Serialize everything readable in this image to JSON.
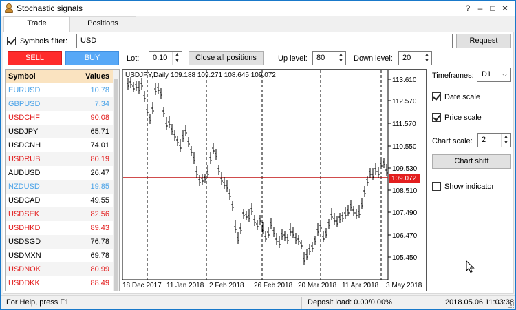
{
  "window": {
    "title": "Stochastic signals",
    "buttons": [
      "?",
      "–",
      "□",
      "✕"
    ]
  },
  "tabs": [
    {
      "label": "Trade",
      "active": true
    },
    {
      "label": "Positions",
      "active": false
    }
  ],
  "filter": {
    "label": "Symbols filter:",
    "checked": true,
    "value": "USD",
    "request_label": "Request"
  },
  "trade": {
    "sell_label": "SELL",
    "buy_label": "BUY",
    "lot_label": "Lot:",
    "lot_value": "0.10",
    "close_all_label": "Close all positions",
    "up_level_label": "Up level:",
    "up_level_value": "80",
    "down_level_label": "Down level:",
    "down_level_value": "20"
  },
  "colors": {
    "sell": "#ff2b2b",
    "buy": "#57a8f7",
    "red_text": "#e31e1e",
    "blue_text": "#4ba3e8",
    "price_line": "#c01010"
  },
  "symbols": {
    "header_symbol": "Symbol",
    "header_values": "Values",
    "rows": [
      {
        "symbol": "EURUSD",
        "value": "10.78",
        "color": "blue"
      },
      {
        "symbol": "GBPUSD",
        "value": "7.34",
        "color": "blue"
      },
      {
        "symbol": "USDCHF",
        "value": "90.08",
        "color": "red"
      },
      {
        "symbol": "USDJPY",
        "value": "65.71",
        "color": "black"
      },
      {
        "symbol": "USDCNH",
        "value": "74.01",
        "color": "black"
      },
      {
        "symbol": "USDRUB",
        "value": "80.19",
        "color": "red"
      },
      {
        "symbol": "AUDUSD",
        "value": "26.47",
        "color": "black"
      },
      {
        "symbol": "NZDUSD",
        "value": "19.85",
        "color": "blue"
      },
      {
        "symbol": "USDCAD",
        "value": "49.55",
        "color": "black"
      },
      {
        "symbol": "USDSEK",
        "value": "82.56",
        "color": "red"
      },
      {
        "symbol": "USDHKD",
        "value": "89.43",
        "color": "red"
      },
      {
        "symbol": "USDSGD",
        "value": "76.78",
        "color": "black"
      },
      {
        "symbol": "USDMXN",
        "value": "69.78",
        "color": "black"
      },
      {
        "symbol": "USDNOK",
        "value": "80.99",
        "color": "red"
      },
      {
        "symbol": "USDDKK",
        "value": "88.49",
        "color": "red"
      }
    ]
  },
  "chart": {
    "header": "USDJPY,Daily  109.188 109.271 108.645 109.072",
    "price_axis": [
      "113.610",
      "112.570",
      "111.570",
      "110.550",
      "109.530",
      "108.510",
      "107.490",
      "106.470",
      "105.450"
    ],
    "current_price": "109.072",
    "date_axis": [
      "18 Dec 2017",
      "11 Jan 2018",
      "2 Feb 2018",
      "26 Feb 2018",
      "20 Mar 2018",
      "11 Apr 2018",
      "3 May 2018"
    ]
  },
  "side": {
    "timeframes_label": "Timeframes:",
    "timeframe_value": "D1",
    "date_scale_label": "Date scale",
    "date_scale_checked": true,
    "price_scale_label": "Price scale",
    "price_scale_checked": true,
    "chart_scale_label": "Chart scale:",
    "chart_scale_value": "2",
    "chart_shift_label": "Chart shift",
    "show_indicator_label": "Show indicator",
    "show_indicator_checked": false
  },
  "status": {
    "help": "For Help, press F1",
    "deposit_load": "Deposit load: 0.00/0.00%",
    "datetime": "2018.05.06 11:03:38"
  }
}
